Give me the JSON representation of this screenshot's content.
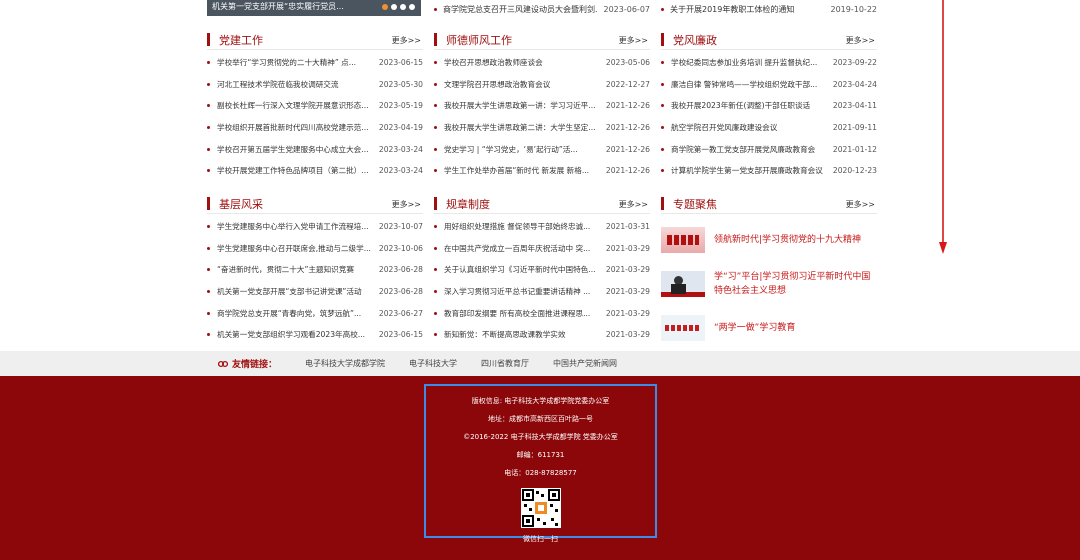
{
  "top": {
    "slider_caption": "机关第一党支部开展“忠实履行党员...",
    "mid_item": {
      "title": "商学院党总支召开三风建设动员大会暨利剑...",
      "date": "2023-06-07"
    },
    "right_item": {
      "title": "关于开展2019年教职工体检的通知",
      "date": "2019-10-22"
    }
  },
  "more_label": "更多>>",
  "sections": {
    "party_building": {
      "title": "党建工作",
      "items": [
        {
          "title": "学校举行“学习贯彻党的二十大精神” 点...",
          "date": "2023-06-15"
        },
        {
          "title": "河北工程技术学院莅临我校调研交流",
          "date": "2023-05-30"
        },
        {
          "title": "副校长杜辉一行深入文理学院开展意识形态...",
          "date": "2023-05-19"
        },
        {
          "title": "学校组织开展首批新时代四川高校党建示范...",
          "date": "2023-04-19"
        },
        {
          "title": "学校召开第五届学生党建服务中心成立大会...",
          "date": "2023-03-24"
        },
        {
          "title": "学校开展党建工作特色品牌项目（第二批）...",
          "date": "2023-03-24"
        }
      ]
    },
    "teacher_ethics": {
      "title": "师德师风工作",
      "items": [
        {
          "title": "学校召开思想政治教师座谈会",
          "date": "2023-05-06"
        },
        {
          "title": "文理学院召开思想政治教育会议",
          "date": "2022-12-27"
        },
        {
          "title": "我校开展大学生讲思政第一讲：学习习近平...",
          "date": "2021-12-26"
        },
        {
          "title": "我校开展大学生讲思政第二讲：大学生坚定...",
          "date": "2021-12-26"
        },
        {
          "title": "党史学习 | “学习党史，‘易’起行动”活...",
          "date": "2021-12-26"
        },
        {
          "title": "学生工作处举办首届“新时代 新发展 新格...",
          "date": "2021-12-26"
        }
      ]
    },
    "integrity": {
      "title": "党风廉政",
      "items": [
        {
          "title": "学校纪委同志参加业务培训 提升监督执纪...",
          "date": "2023-09-22"
        },
        {
          "title": "廉洁自律 警钟常鸣——学校组织党政干部...",
          "date": "2023-04-24"
        },
        {
          "title": "我校开展2023年新任(调整)干部任职谈话",
          "date": "2023-04-11"
        },
        {
          "title": "航空学院召开党风廉政建设会议",
          "date": "2021-09-11"
        },
        {
          "title": "商学院第一教工党支部开展党风廉政教育会",
          "date": "2021-01-12"
        },
        {
          "title": "计算机学院学生第一党支部开展廉政教育会议",
          "date": "2020-12-23"
        }
      ]
    },
    "grassroots": {
      "title": "基层风采",
      "items": [
        {
          "title": "学生党建服务中心举行入党申请工作流程培...",
          "date": "2023-10-07"
        },
        {
          "title": "学生党建服务中心召开联席会,推动与二级学...",
          "date": "2023-10-06"
        },
        {
          "title": "“奋进新时代，贯彻二十大”主题知识竞赛",
          "date": "2023-06-28"
        },
        {
          "title": "机关第一党支部开展“支部书记讲党课”活动",
          "date": "2023-06-28"
        },
        {
          "title": "商学院党总支开展“青春向党，筑梦远航”...",
          "date": "2023-06-27"
        },
        {
          "title": "机关第一党支部组织学习观看2023年高校...",
          "date": "2023-06-15"
        }
      ]
    },
    "regulations": {
      "title": "规章制度",
      "items": [
        {
          "title": "用好组织处理措施 督促领导干部始终忠诚...",
          "date": "2021-03-31"
        },
        {
          "title": "在中国共产党成立一百周年庆祝活动中 突...",
          "date": "2021-03-29"
        },
        {
          "title": "关于认真组织学习《习近平新时代中国特色...",
          "date": "2021-03-29"
        },
        {
          "title": "深入学习贯彻习近平总书记重要讲话精神 ...",
          "date": "2021-03-29"
        },
        {
          "title": "教育部印发纲要 所有高校全面推进课程思...",
          "date": "2021-03-29"
        },
        {
          "title": "新知新觉：不断提高思政课教学实效",
          "date": "2021-03-29"
        }
      ]
    },
    "topics": {
      "title": "专题聚焦",
      "items": [
        {
          "title": "领航新时代|学习贯彻党的十九大精神"
        },
        {
          "title": "学“习”平台|学习贯彻习近平新时代中国特色社会主义思想"
        },
        {
          "title": "“两学一做”学习教育"
        }
      ]
    }
  },
  "friend_links": {
    "label": "友情链接：",
    "items": [
      "电子科技大学成都学院",
      "电子科技大学",
      "四川省教育厅",
      "中国共产党新闻网"
    ]
  },
  "footer": {
    "copyright_owner": "版权信息: 电子科技大学成都学院党委办公室",
    "address": "地址：成都市高新西区百叶路一号",
    "copyright": "©2016-2022 电子科技大学成都学院 党委办公室",
    "postcode": "邮编：611731",
    "phone": "电话：028-87828577",
    "qr_caption": "微信扫一扫"
  },
  "colors": {
    "accent": "#a01010",
    "footer_bg": "#8c0709",
    "focus_border": "#3c8be8",
    "topic_text": "#c81818"
  },
  "icons": {
    "friend_links": "link-icon",
    "scroll_hint": "down-arrow-icon"
  }
}
